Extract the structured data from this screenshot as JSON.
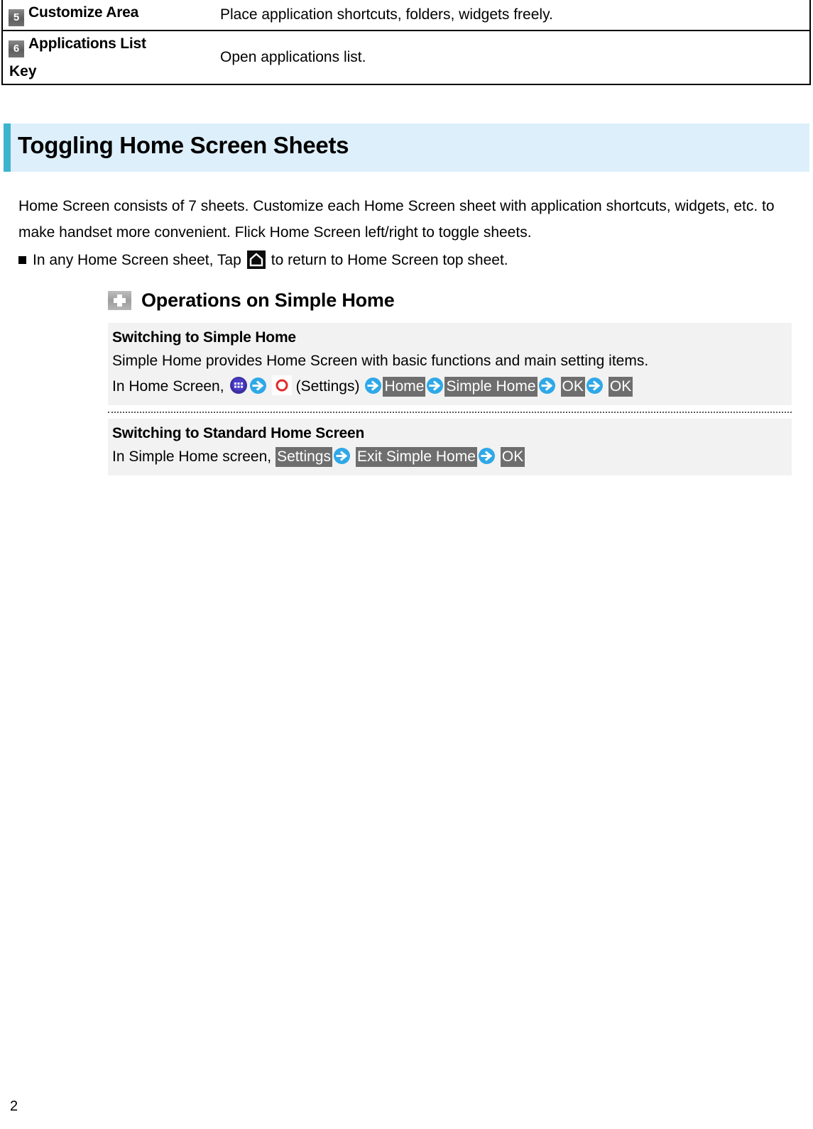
{
  "legend_table": {
    "rows": [
      {
        "badge": "5",
        "label": "Customize Area",
        "label_line2": "",
        "description": "Place application shortcuts, folders, widgets freely."
      },
      {
        "badge": "6",
        "label": "Applications List",
        "label_line2": "Key",
        "description": "Open applications list."
      }
    ]
  },
  "section": {
    "title": "Toggling Home Screen Sheets",
    "accent_color": "#3cb4cd",
    "banner_color": "#ddeffb"
  },
  "intro": {
    "paragraph": "Home Screen consists of 7 sheets. Customize each Home Screen sheet with application shortcuts, widgets, etc. to make handset more convenient. Flick Home Screen left/right to toggle sheets.",
    "bullet_prefix": "In any Home Screen sheet, Tap",
    "bullet_suffix": "to return to Home Screen top sheet.",
    "bullet_icon": "home-key-icon"
  },
  "operations": {
    "icon": "plus-icon",
    "title": "Operations on Simple Home",
    "procedures": [
      {
        "title": "Switching to Simple Home",
        "description": "Simple Home provides Home Screen with basic functions and main setting items.",
        "steps_prefix": "In Home Screen,",
        "settings_label": "(Settings)",
        "chips": [
          "Home",
          "Simple Home",
          "OK",
          "OK"
        ]
      },
      {
        "title": "Switching to Standard Home Screen",
        "description": "",
        "steps_prefix": "In Simple Home screen,",
        "chips": [
          "Settings",
          "Exit Simple Home",
          "OK"
        ]
      }
    ]
  },
  "footer": {
    "page_number": "2"
  },
  "icons": {
    "apps_grid": "apps-grid-icon",
    "arrow_right": "blue-arrow-right-icon",
    "settings_gear": "settings-gear-icon",
    "home": "home-icon",
    "plus": "plus-icon"
  },
  "colors": {
    "chip_bg": "#6e6e6e",
    "box_bg": "#f2f2f2",
    "arrow_blue": "#2fa8e8",
    "apps_purple": "#3b2fa0",
    "gear_red": "#e02b28"
  }
}
